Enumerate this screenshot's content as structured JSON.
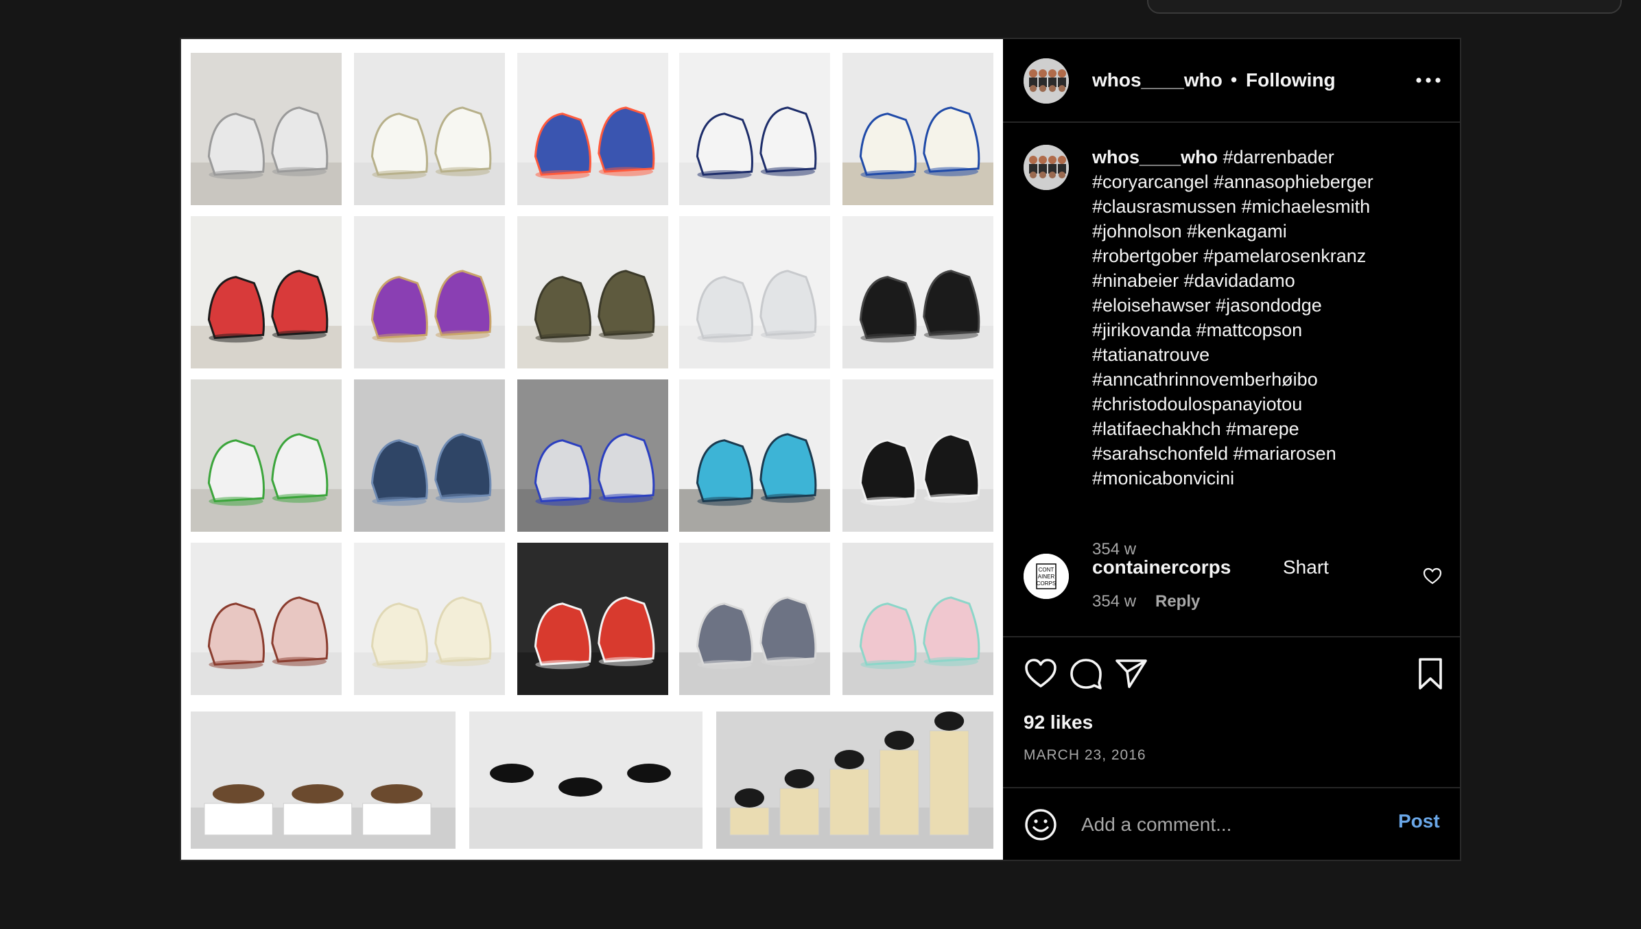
{
  "post": {
    "username": "whos____who",
    "separator": "•",
    "follow_state": "Following",
    "caption_lines": [
      "#darrenbader",
      "#coryarcangel #annasophieberger",
      "#clausrasmussen #michaelesmith",
      "#johnolson #kenkagami",
      "#robertgober #pamelarosenkranz",
      "#ninabeier #davidadamo",
      "#eloisehawser #jasondodge",
      "#jirikovanda #mattcopson",
      "#tatianatrouve",
      "#anncathrinnovemberhøibo",
      "#christodoulospanayiotou",
      "#latifaechakhch #marepe",
      "#sarahschonfeld #mariarosen",
      "#monicabonvicini"
    ],
    "caption_time": "354 w",
    "likes": "92 likes",
    "date": "MARCH 23, 2016"
  },
  "comment": {
    "username": "containercorps",
    "text": "Shart",
    "time": "354 w",
    "reply_label": "Reply",
    "avatar_text": [
      "CONT",
      "AINER",
      "CORPS"
    ]
  },
  "composer": {
    "placeholder": "Add a comment...",
    "post_label": "Post"
  },
  "icons": {
    "more": "more-horizontal-icon",
    "like": "heart-icon",
    "comment": "comment-bubble-icon",
    "share": "paper-plane-icon",
    "save": "bookmark-icon",
    "emoji": "smiley-icon"
  },
  "colors": {
    "background": "#161616",
    "panel": "#000000",
    "divider": "#262626",
    "secondary_text": "#a8a8a8",
    "link_blue": "#6aa7e8"
  },
  "media": {
    "tiles": [
      {
        "bg": "#dcdad6",
        "shoe": "#e8e8e8",
        "accent": "#9a9a9a",
        "floor": "#c9c6c0"
      },
      {
        "bg": "#e9e9e9",
        "shoe": "#f7f7f2",
        "accent": "#b7b08a",
        "floor": "#e0e0e0"
      },
      {
        "bg": "#eeeeee",
        "shoe": "#3a55b0",
        "accent": "#ff5a3c",
        "floor": "#e4e4e4"
      },
      {
        "bg": "#f1f1f1",
        "shoe": "#f4f4f4",
        "accent": "#1d2d6a",
        "floor": "#e8e8e8"
      },
      {
        "bg": "#eaeaea",
        "shoe": "#f5f3ea",
        "accent": "#1f4aa8",
        "floor": "#cfc8b8"
      },
      {
        "bg": "#ededea",
        "shoe": "#d83a3a",
        "accent": "#1a1a1a",
        "floor": "#d8d4cc"
      },
      {
        "bg": "#ececec",
        "shoe": "#8a3fb3",
        "accent": "#c9a46a",
        "floor": "#e3e3e3"
      },
      {
        "bg": "#ebebea",
        "shoe": "#5e5a3e",
        "accent": "#3c3a2a",
        "floor": "#dedbd3"
      },
      {
        "bg": "#f2f2f2",
        "shoe": "#e2e4e6",
        "accent": "#c8cacd",
        "floor": "#ececec"
      },
      {
        "bg": "#efefef",
        "shoe": "#1b1b1b",
        "accent": "#444444",
        "floor": "#e6e6e6"
      },
      {
        "bg": "#dcdcd8",
        "shoe": "#f2f2f2",
        "accent": "#3ba53b",
        "floor": "#c8c6c0"
      },
      {
        "bg": "#c9c9c9",
        "shoe": "#2f4566",
        "accent": "#6f8bb3",
        "floor": "#b9b9b9"
      },
      {
        "bg": "#8f8f8f",
        "shoe": "#d9dadd",
        "accent": "#2b3fbf",
        "floor": "#7c7c7c"
      },
      {
        "bg": "#efefef",
        "shoe": "#3db4d6",
        "accent": "#1b3a4f",
        "floor": "#a8a7a3"
      },
      {
        "bg": "#eaeaea",
        "shoe": "#171717",
        "accent": "#f2f2f2",
        "floor": "#dcdcdc"
      },
      {
        "bg": "#ececec",
        "shoe": "#e8c7c2",
        "accent": "#8a3c2e",
        "floor": "#e2e2e2"
      },
      {
        "bg": "#efefef",
        "shoe": "#f3eed8",
        "accent": "#e0d8b5",
        "floor": "#e6e6e6"
      },
      {
        "bg": "#2b2b2b",
        "shoe": "#d83a2e",
        "accent": "#f4f4f4",
        "floor": "#1f1f1f"
      },
      {
        "bg": "#ededed",
        "shoe": "#6d7384",
        "accent": "#d8d8d8",
        "floor": "#cfcfcf"
      },
      {
        "bg": "#e6e6e6",
        "shoe": "#f0c7cf",
        "accent": "#8cd6c9",
        "floor": "#d2d2d2"
      },
      {
        "bg": "#e3e3e3",
        "shoe": "#6b4a2e",
        "accent": "#ffffff",
        "floor": "#cfcfcf"
      },
      {
        "bg": "#e9e9e9",
        "shoe": "#111111",
        "accent": "#3a3a3a",
        "floor": "#dedede"
      },
      {
        "bg": "#d6d6d6",
        "shoe": "#1a1a1a",
        "accent": "#eadcb2",
        "floor": "#c9c9c9"
      }
    ]
  }
}
